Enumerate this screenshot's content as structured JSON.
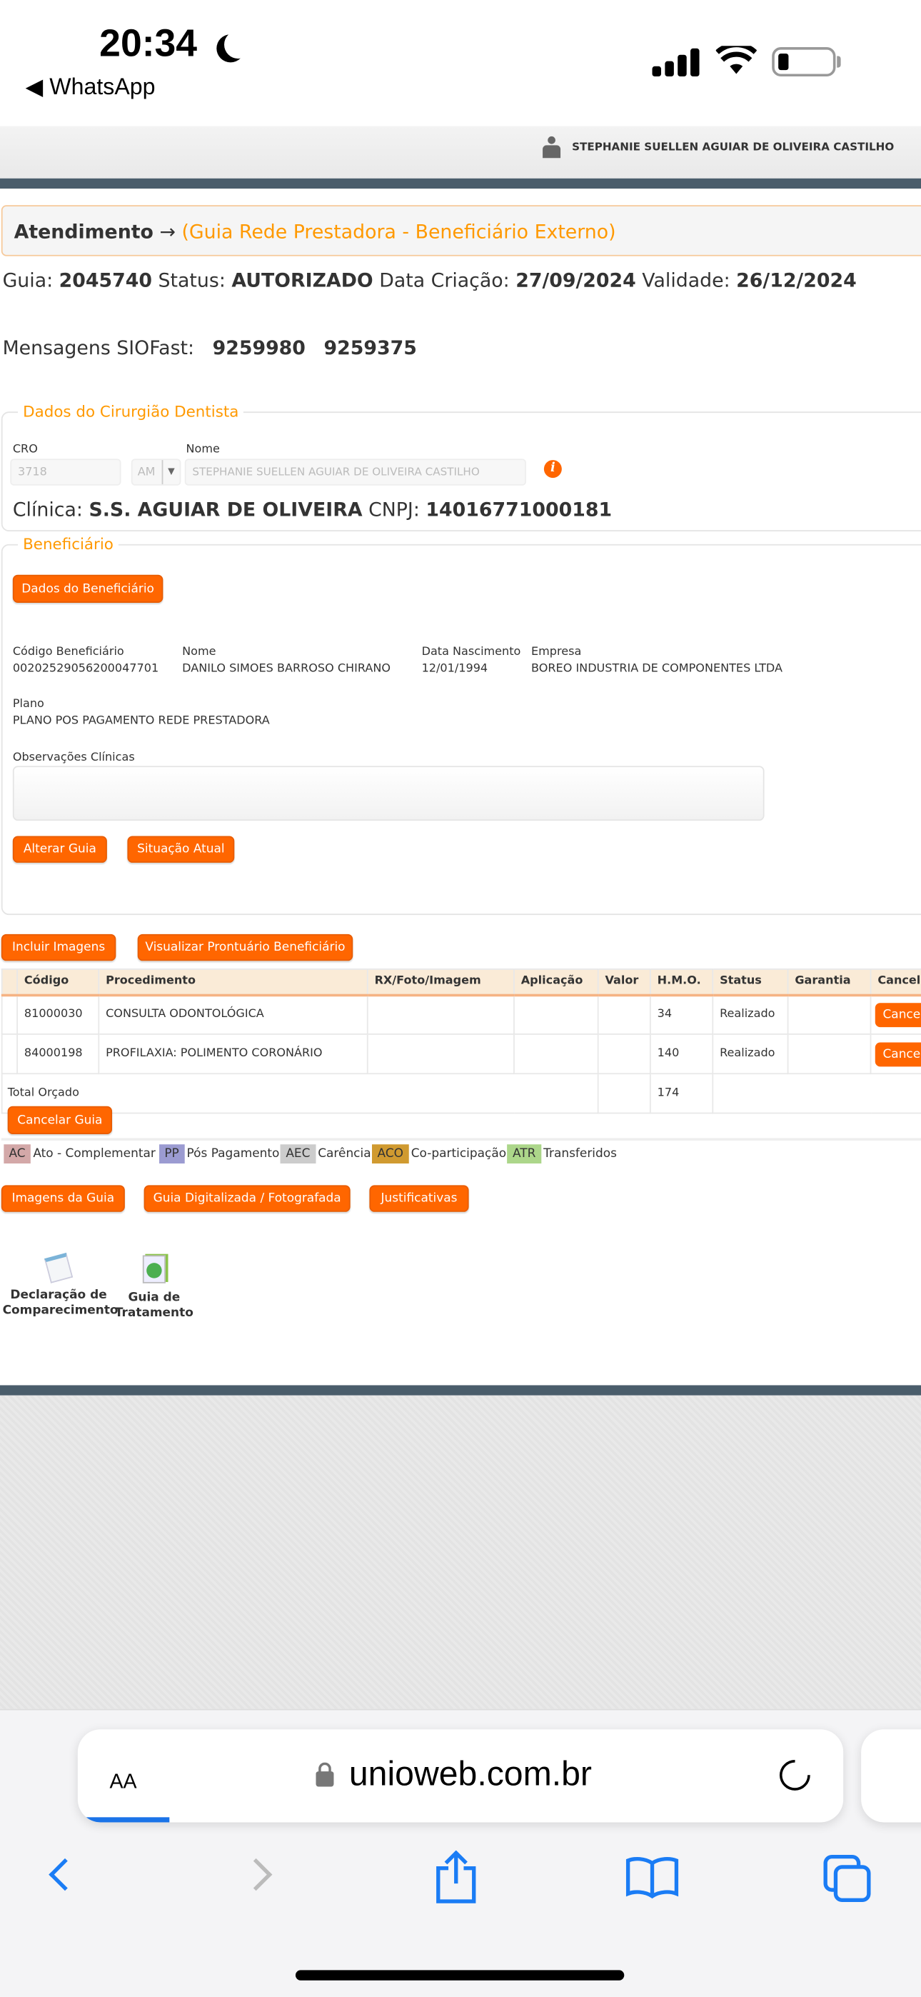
{
  "status_bar": {
    "time": "20:34",
    "back_app": "◀ WhatsApp"
  },
  "header": {
    "user_name": "STEPHANIE SUELLEN AGUIAR DE OLIVEIRA CASTILHO"
  },
  "breadcrumb": {
    "root": "Atendimento",
    "arrow": "→",
    "current": "(Guia Rede Prestadora - Beneficiário Externo)"
  },
  "guia": {
    "guia_label": "Guia:",
    "guia_value": "2045740",
    "status_label": "Status:",
    "status_value": "AUTORIZADO",
    "criacao_label": "Data Criação:",
    "criacao_value": "27/09/2024",
    "validade_label": "Validade:",
    "validade_value": "26/12/2024"
  },
  "mensagens": {
    "label": "Mensagens SIOFast:",
    "values": [
      "9259980",
      "9259375"
    ]
  },
  "dentista": {
    "legend": "Dados do Cirurgião Dentista",
    "cro_label": "CRO",
    "cro_value": "3718",
    "uf_value": "AM",
    "nome_label": "Nome",
    "nome_value": "STEPHANIE SUELLEN AGUIAR DE OLIVEIRA CASTILHO",
    "clinica_label": "Clínica:",
    "clinica_value": "S.S. AGUIAR DE OLIVEIRA",
    "cnpj_label": "CNPJ:",
    "cnpj_value": "14016771000181"
  },
  "beneficiario": {
    "legend": "Beneficiário",
    "dados_button": "Dados do Beneficiário",
    "codigo_label": "Código Beneficiário",
    "codigo_value": "00202529056200047701",
    "nome_label": "Nome",
    "nome_value": "DANILO SIMOES BARROSO CHIRANO",
    "nasc_label": "Data Nascimento",
    "nasc_value": "12/01/1994",
    "empresa_label": "Empresa",
    "empresa_value": "BOREO INDUSTRIA DE COMPONENTES LTDA",
    "plano_label": "Plano",
    "plano_value": "PLANO POS PAGAMENTO REDE PRESTADORA",
    "obs_label": "Observações Clínicas",
    "alterar_button": "Alterar Guia",
    "situacao_button": "Situação Atual"
  },
  "actions": {
    "incluir": "Incluir Imagens",
    "visualizar": "Visualizar Prontuário Beneficiário"
  },
  "table": {
    "headers": [
      "Código",
      "Procedimento",
      "RX/Foto/Imagem",
      "Aplicação",
      "Valor",
      "H.M.O.",
      "Status",
      "Garantia",
      "Cancela"
    ],
    "rows": [
      {
        "codigo": "81000030",
        "procedimento": "CONSULTA ODONTOLÓGICA",
        "hmo": "34",
        "status": "Realizado",
        "cancel": "Cancel"
      },
      {
        "codigo": "84000198",
        "procedimento": "PROFILAXIA: POLIMENTO CORONÁRIO",
        "hmo": "140",
        "status": "Realizado",
        "cancel": "Cancel"
      }
    ],
    "total_label": "Total Orçado",
    "total_hmo": "174"
  },
  "cancelar_guia": "Cancelar Guia",
  "legend_items": [
    {
      "code": "AC",
      "label": "Ato - Complementar",
      "color": "#d3a8a8"
    },
    {
      "code": "PP",
      "label": "Pós Pagamento",
      "color": "#9b9bd1"
    },
    {
      "code": "AEC",
      "label": "Carência",
      "color": "#cccccc"
    },
    {
      "code": "ACO",
      "label": "Co-participação",
      "color": "#d09a30"
    },
    {
      "code": "ATR",
      "label": "Transferidos",
      "color": "#acd68a"
    }
  ],
  "bottom_buttons": [
    "Imagens da Guia",
    "Guia Digitalizada / Fotografada",
    "Justificativas"
  ],
  "docs": [
    {
      "line1": "Declaração de",
      "line2": "Comparecimento"
    },
    {
      "line1": "Guia de",
      "line2": "Tratamento"
    }
  ],
  "browser": {
    "aa": "AA",
    "url": "unioweb.com.br"
  },
  "colors": {
    "accent": "#ff6600",
    "dark_bar": "#4a5d6b"
  }
}
